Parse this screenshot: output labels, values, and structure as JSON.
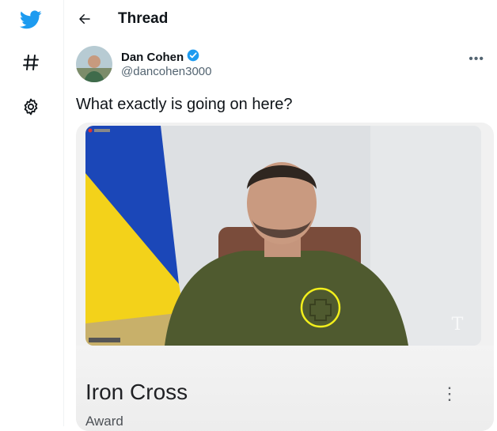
{
  "header": {
    "title": "Thread"
  },
  "tweet": {
    "author_name": "Dan Cohen",
    "author_handle": "@dancohen3000",
    "text": "What exactly is going on here?"
  },
  "card": {
    "title": "Iron Cross",
    "subtitle": "Award"
  },
  "icons": {
    "logo": "bird-icon",
    "nav": [
      "hashtag-icon",
      "gear-icon"
    ],
    "back": "arrow-left-icon",
    "verified": "verified-badge-icon",
    "more": "more-horizontal-icon",
    "card_more": "more-vertical-icon",
    "watermark": "nyt-logo-icon"
  },
  "colors": {
    "brand": "#1d9bf0",
    "annotation": "#f2ef1c",
    "shirt": "#4f5a2f"
  }
}
